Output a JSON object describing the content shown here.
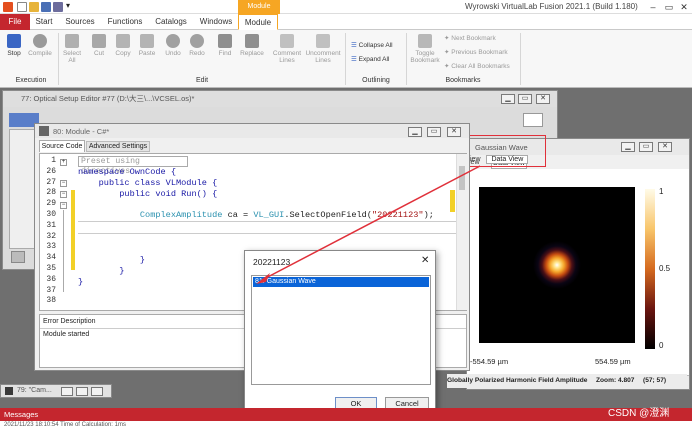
{
  "app": {
    "title": "Wyrowski VirtualLab Fusion 2021.1 (Build 1.180)",
    "context_tab": "Module"
  },
  "tabs": [
    "File",
    "Start",
    "Sources",
    "Functions",
    "Catalogs",
    "Windows",
    "Module"
  ],
  "ribbon": {
    "execution": {
      "stop": "Stop",
      "compile": "Compile",
      "group": "Execution"
    },
    "edit": {
      "select_all": "Select All",
      "cut": "Cut",
      "copy": "Copy",
      "paste": "Paste",
      "undo": "Undo",
      "redo": "Redo",
      "find": "Find",
      "replace": "Replace",
      "comment": "Comment Lines",
      "uncomment": "Uncomment Lines",
      "group": "Edit"
    },
    "outlining": {
      "collapse": "Collapse All",
      "expand": "Expand All",
      "group": "Outlining"
    },
    "bookmarks": {
      "toggle": "Toggle Bookmark",
      "next": "Next Bookmark",
      "previous": "Previous Bookmark",
      "clear": "Clear All Bookmarks",
      "group": "Bookmarks"
    }
  },
  "optical_setup": {
    "title": "77: Optical Setup Editor #77 (D:\\大三\\...\\VCSEL.os)*"
  },
  "module_window": {
    "title": "80: Module - C#*",
    "tabs": [
      "Source Code",
      "Advanced Settings"
    ],
    "line_numbers": [
      "1",
      "26",
      "27",
      "28",
      "29",
      "30",
      "31",
      "32",
      "33",
      "34",
      "35",
      "36",
      "37",
      "38"
    ],
    "collapsed_region": "Preset using directives",
    "code_lines": [
      "",
      "",
      "namespace OwnCode {",
      "    public class VLModule {",
      "        public void Run() {",
      "",
      "",
      "",
      "",
      "",
      "            }",
      "        }",
      "}",
      ""
    ],
    "code_line31": {
      "type": "ComplexAmplitude",
      "var": " ca = ",
      "cls": "VL_GUI",
      "method": ".SelectOpenField(",
      "arg": "\"20221123\"",
      "end": ");"
    },
    "error_header": "Error Description",
    "message": "Module started"
  },
  "field_window": {
    "title": "Gaussian Wave",
    "tabs": [
      "iew",
      "Data View"
    ],
    "x_left": "-554.59 µm",
    "x_right": "554.59 µm",
    "colorbar_ticks": [
      "1",
      "0.5",
      "0"
    ],
    "status_label": "Globally Polarized Harmonic Field Amplitude",
    "zoom": "Zoom: 4.807",
    "coords": "(57; 57)"
  },
  "dialog": {
    "title": "20221123",
    "item": "81: Gaussian Wave",
    "ok": "OK",
    "cancel": "Cancel"
  },
  "minimized": {
    "camera_title": "79: \"Cam..."
  },
  "messages_bar": "Messages",
  "watermark": "CSDN @澄渊",
  "bottom_text": "2021/11/23 18:10:54 Time of Calculation: 1ms",
  "colors": {
    "file_tab": "#c4262e",
    "accent": "#f6a623",
    "selection": "#0a64d8",
    "highlight_box": "#e0303a"
  }
}
